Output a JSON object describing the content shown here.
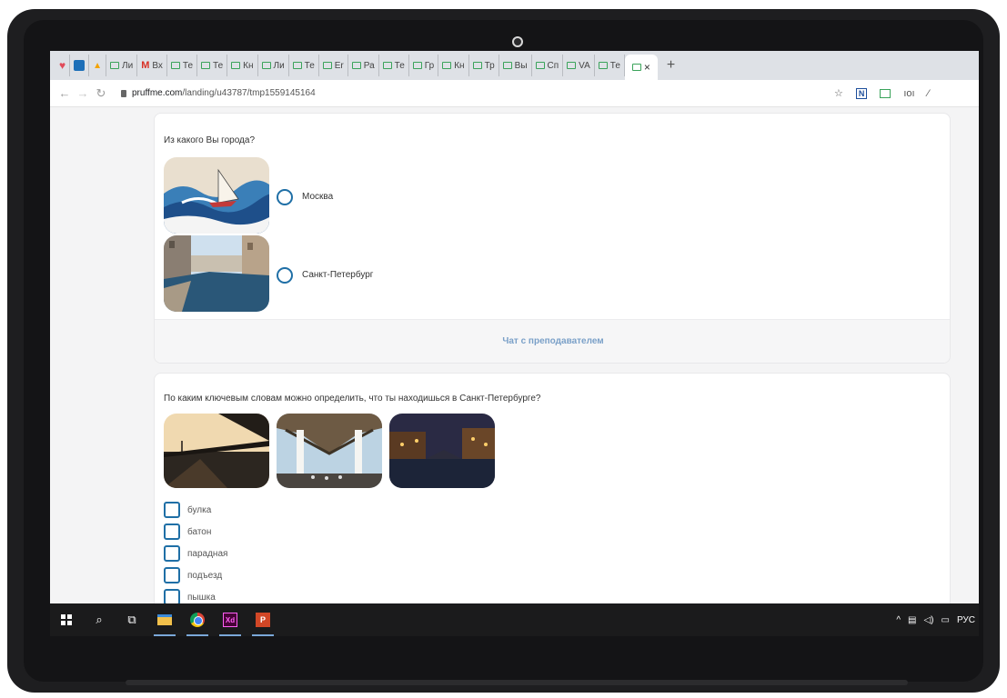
{
  "browser": {
    "tabs": [
      {
        "icon": "vivaldi-icon",
        "label": ""
      },
      {
        "icon": "trello-icon",
        "label": ""
      },
      {
        "icon": "drive-icon",
        "label": ""
      },
      {
        "icon": "page-icon",
        "label": "Ли"
      },
      {
        "icon": "gmail-icon",
        "label": "Вх"
      },
      {
        "icon": "page-icon",
        "label": "Те"
      },
      {
        "icon": "page-icon",
        "label": "Те"
      },
      {
        "icon": "page-icon",
        "label": "Кн"
      },
      {
        "icon": "page-icon",
        "label": "Ли"
      },
      {
        "icon": "page-icon",
        "label": "Те"
      },
      {
        "icon": "page-icon",
        "label": "Er"
      },
      {
        "icon": "page-icon",
        "label": "Ра"
      },
      {
        "icon": "page-icon",
        "label": "Те"
      },
      {
        "icon": "page-icon",
        "label": "Гр"
      },
      {
        "icon": "page-icon",
        "label": "Кн"
      },
      {
        "icon": "page-icon",
        "label": "Тр"
      },
      {
        "icon": "page-icon",
        "label": "Вы"
      },
      {
        "icon": "page-icon",
        "label": "Сп"
      },
      {
        "icon": "page-icon",
        "label": "VA"
      },
      {
        "icon": "page-icon",
        "label": "Те"
      }
    ],
    "active_tab_close": "×",
    "new_tab": "+",
    "url_host": "pruffme.com",
    "url_path": "/landing/u43787/tmp1559145164"
  },
  "question1": {
    "text": "Из какого Вы города?",
    "options": [
      {
        "label": "Москва",
        "image": "sailboat-painting"
      },
      {
        "label": "Санкт-Петербург",
        "image": "canal-photo"
      }
    ],
    "chat_label": "Чат с преподавателем"
  },
  "question2": {
    "text": "По каким ключевым словам можно определить, что ты находишься в Санкт-Петербурге?",
    "images": [
      "bridge-sunset",
      "bridge-underside",
      "canal-night"
    ],
    "options": [
      "булка",
      "батон",
      "парадная",
      "подъезд",
      "пышка"
    ]
  },
  "taskbar": {
    "tray_text": "РУС"
  },
  "colors": {
    "accent": "#1f6fa6",
    "chat_link": "#7aa0c8"
  }
}
